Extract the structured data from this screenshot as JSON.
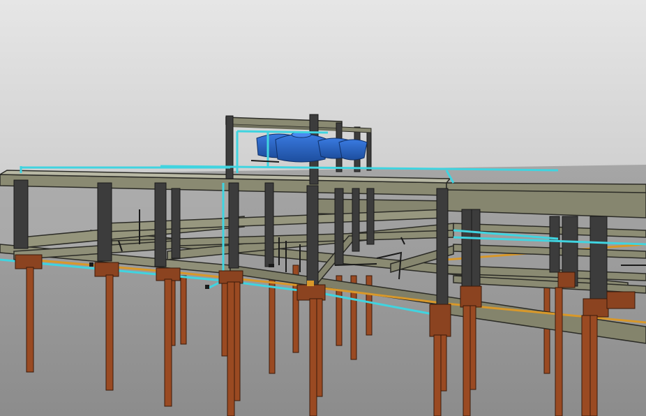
{
  "scene": {
    "subject": "",
    "colors": {
      "sky_top": "#e4e4e4",
      "sky_bottom": "#d2d2d2",
      "ground_far": "#a2a2a2",
      "ground_near": "#8f8f8f",
      "beam": "#8a8a72",
      "beam_edge": "#2b2b26",
      "column": "#3c3c3c",
      "pile": "#9a4a22",
      "pile_cap": "#8b4320",
      "water_pipe": "#40d4e0",
      "drain_pipe": "#e0a030",
      "tank": "#2a63c0",
      "dark_pipe": "#1a1a1a"
    }
  }
}
